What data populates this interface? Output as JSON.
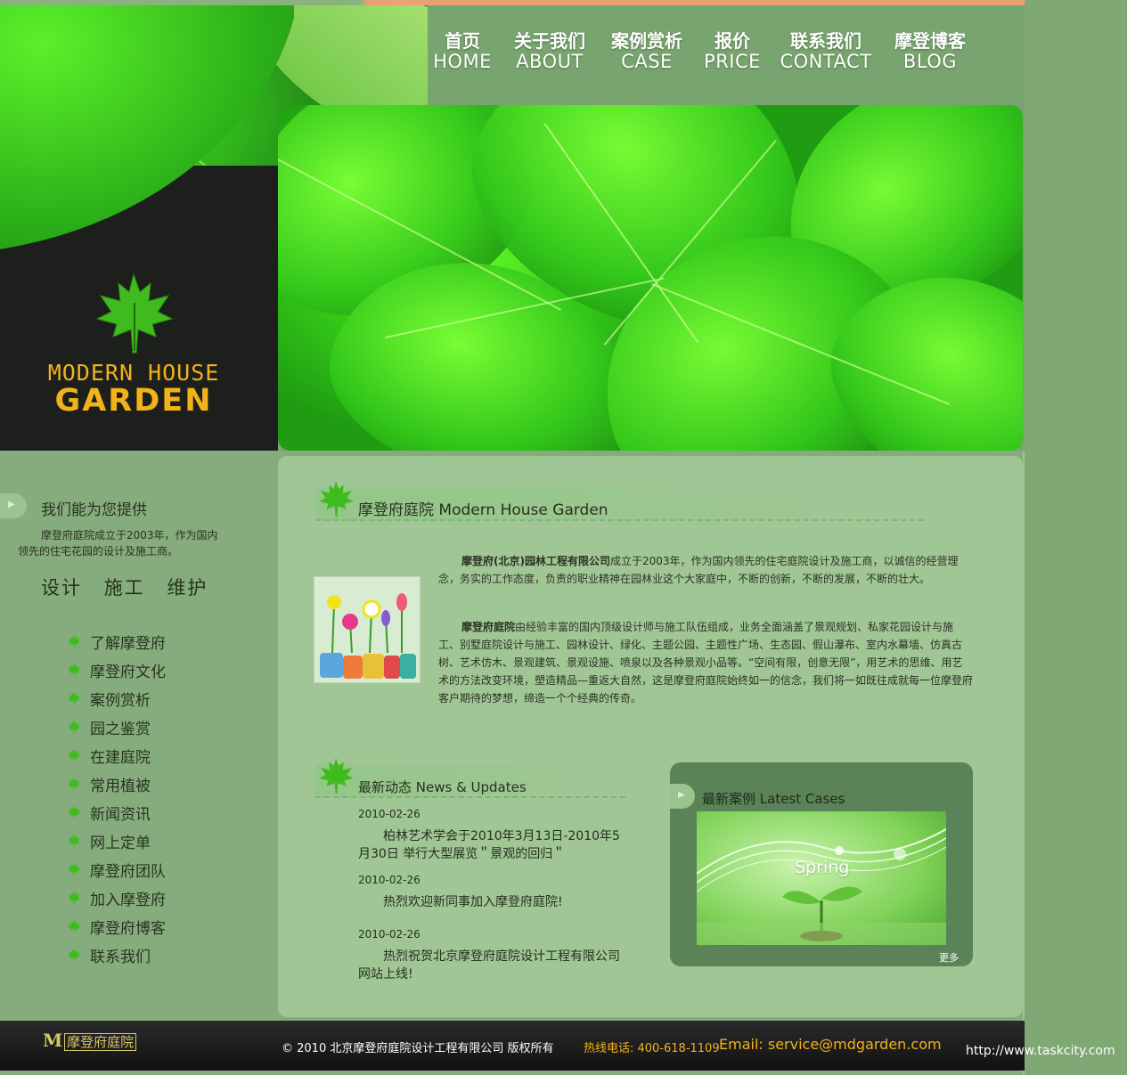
{
  "nav": {
    "items": [
      {
        "zh": "首页",
        "en": "HOME"
      },
      {
        "zh": "关于我们",
        "en": "ABOUT"
      },
      {
        "zh": "案例赏析",
        "en": "CASE"
      },
      {
        "zh": "报价",
        "en": "PRICE"
      },
      {
        "zh": "联系我们",
        "en": "CONTACT"
      },
      {
        "zh": "摩登博客",
        "en": "BLOG"
      }
    ]
  },
  "logo": {
    "line1": "MODERN HOUSE",
    "line2": "GARDEN"
  },
  "sidebar": {
    "title": "我们能为您提供",
    "intro": "摩登府庭院成立于2003年，作为国内领先的住宅花园的设计及施工商。",
    "services": [
      "设计",
      "施工",
      "维护"
    ],
    "menu": [
      "了解摩登府",
      "摩登府文化",
      "案例赏析",
      "园之鉴赏",
      "在建庭院",
      "常用植被",
      "新闻资讯",
      "网上定单",
      "摩登府团队",
      "加入摩登府",
      "摩登府博客",
      "联系我们"
    ]
  },
  "about": {
    "title": "摩登府庭院 Modern House Garden",
    "p1_bold": "摩登府(北京)园林工程有限公司",
    "p1": "成立于2003年，作为国内领先的住宅庭院设计及施工商，以诚信的经营理念，务实的工作态度，负责的职业精神在园林业这个大家庭中，不断的创新，不断的发展，不断的壮大。",
    "p2_bold": "摩登府庭院",
    "p2": "由经验丰富的国内顶级设计师与施工队伍组成，业务全面涵盖了景观规划、私家花园设计与施工、别墅庭院设计与施工、园林设计、绿化、主题公园、主题性广场、生态园、假山瀑布、室内水幕墙、仿真古树、艺术仿木、景观建筑、景观设施、喷泉以及各种景观小品等。“空间有限，创意无限”，用艺术的思维、用艺术的方法改变环境，塑造精品—重返大自然，这是摩登府庭院始终如一的信念，我们将一如既往成就每一位摩登府客户期待的梦想，缔造一个个经典的传奇。"
  },
  "news": {
    "title": "最新动态 News & Updates",
    "items": [
      {
        "date": "2010-02-26",
        "text": "柏林艺术学会于2010年3月13日-2010年5月30日 举行大型展览＂景观的回归＂"
      },
      {
        "date": "2010-02-26",
        "text": "热烈欢迎新同事加入摩登府庭院!"
      },
      {
        "date": "2010-02-26",
        "text": "热烈祝贺北京摩登府庭院设计工程有限公司网站上线!"
      }
    ]
  },
  "cases": {
    "title": "最新案例 Latest Cases",
    "image_text": "Spring",
    "more": "更多"
  },
  "footer": {
    "logo_m": "M",
    "logo_text": "摩登府庭院",
    "copyright": "© 2010  北京摩登府庭院设计工程有限公司   版权所有",
    "hotline": "热线电话: 400-618-1109",
    "email": "Email: service@mdgarden.com"
  },
  "watermark": "http://www.taskcity.com",
  "colors": {
    "accent": "#f3b21a",
    "leaf": "#39d51a",
    "panel": "#a1c696",
    "dark": "#1d1f1d"
  }
}
